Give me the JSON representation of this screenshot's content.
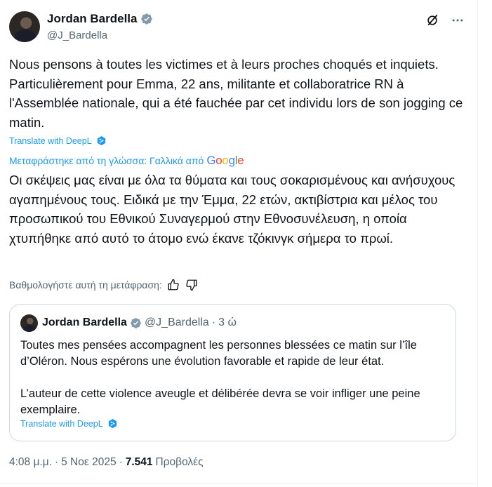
{
  "author": {
    "name": "Jordan Bardella",
    "handle": "@J_Bardella"
  },
  "tweet": {
    "text": "Nous pensons à toutes les victimes et à leurs proches choqués et inquiets. Particulièrement pour Emma, 22 ans, militante et collaboratrice RN à l'Assemblée nationale, qui a été fauchée par cet individu lors de son jogging ce matin.",
    "deepl_label": "Translate with DeepL",
    "translated_by_label": "Μεταφράστηκε από τη γλώσσα: Γαλλικά από",
    "google_label": [
      "G",
      "o",
      "o",
      "g",
      "l",
      "e"
    ],
    "translated_text": "Οι σκέψεις μας είναι με όλα τα θύματα και τους σοκαρισμένους και ανήσυχους αγαπημένους τους. Ειδικά με την Έμμα, 22 ετών, ακτιβίστρια και μέλος του προσωπικού του Εθνικού Συναγερμού στην Εθνοσυνέλευση, η οποία χτυπήθηκε από αυτό το άτομο ενώ έκανε τζόκινγκ σήμερα το πρωί.",
    "rate_label": "Βαθμολογήστε αυτή τη μετάφραση:"
  },
  "quote": {
    "name": "Jordan Bardella",
    "handle": "@J_Bardella",
    "separator": "·",
    "time": "3 ώ",
    "text": "Toutes mes pensées accompagnent les personnes blessées ce matin sur l’île d’Oléron. Nous espérons une évolution favorable et rapide de leur état.\n\nL’auteur de cette violence aveugle et délibérée devra se voir infliger une peine exemplaire.",
    "deepl_label": "Translate with DeepL"
  },
  "meta": {
    "time": "4:08 μ.μ.",
    "separator": "·",
    "date": "5 Νοε 2025",
    "separator2": "·",
    "views": "7.541",
    "views_label": "Προβολές"
  },
  "icons": {
    "verified": "verified-badge-icon",
    "grok": "grok-icon",
    "more": "more-icon",
    "deepl": "deepl-icon",
    "thumbs_up": "thumbs-up-icon",
    "thumbs_down": "thumbs-down-icon"
  },
  "colors": {
    "accent": "#1d9bf0",
    "text": "#0f1419",
    "secondary": "#536471",
    "border": "#cfd9de"
  }
}
